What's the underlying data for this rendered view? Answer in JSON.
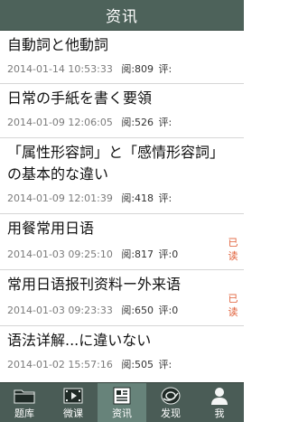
{
  "header": {
    "title": "资讯"
  },
  "articles": [
    {
      "title": "自動詞と他動詞",
      "date": "2014-01-14 10:53:33",
      "views": "阅:809",
      "comments": "评:",
      "read": ""
    },
    {
      "title": "日常の手紙を書く要領",
      "date": "2014-01-09 12:06:05",
      "views": "阅:526",
      "comments": "评:",
      "read": ""
    },
    {
      "title": "「属性形容詞」と「感情形容詞」の基本的な違い",
      "date": "2014-01-09 12:01:39",
      "views": "阅:418",
      "comments": "评:",
      "read": ""
    },
    {
      "title": "用餐常用日语",
      "date": "2014-01-03 09:25:10",
      "views": "阅:817",
      "comments": "评:0",
      "read": "已读"
    },
    {
      "title": "常用日语报刊资料ー外来语",
      "date": "2014-01-03 09:23:33",
      "views": "阅:650",
      "comments": "评:0",
      "read": "已读"
    },
    {
      "title": "语法详解...に違いない",
      "date": "2014-01-02 15:57:16",
      "views": "阅:505",
      "comments": "评:",
      "read": ""
    }
  ],
  "tabs": [
    {
      "label": "题库",
      "icon": "folder-icon",
      "active": false
    },
    {
      "label": "微课",
      "icon": "film-icon",
      "active": false
    },
    {
      "label": "资讯",
      "icon": "news-icon",
      "active": true
    },
    {
      "label": "发现",
      "icon": "compass-icon",
      "active": false
    },
    {
      "label": "我",
      "icon": "person-icon",
      "active": false
    }
  ],
  "colors": {
    "header_bg": "#4d625a",
    "tabbar_bg": "#4a5c56",
    "tab_active_bg": "#67837a",
    "read_badge": "#e0603a"
  }
}
